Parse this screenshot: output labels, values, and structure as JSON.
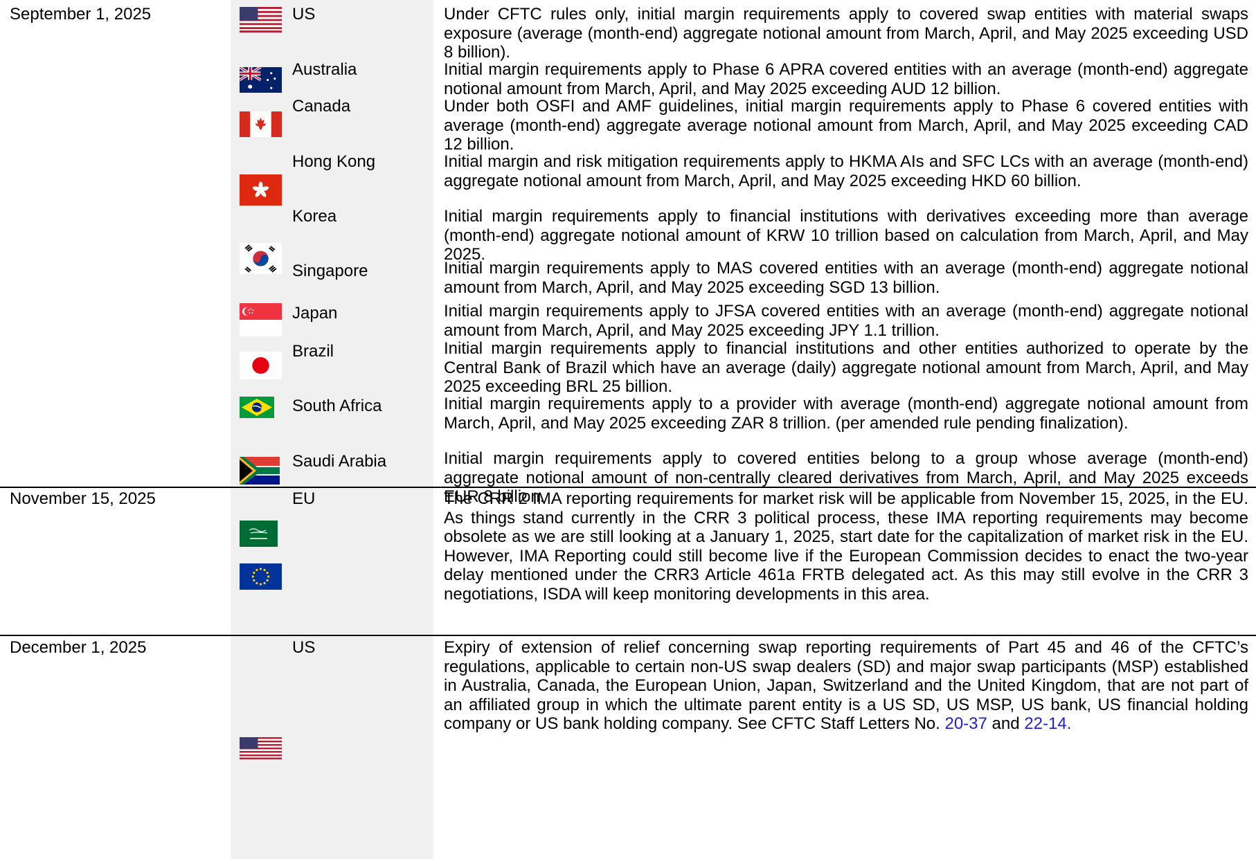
{
  "colors": {
    "accent_link": "#1f1fd6",
    "column_shade": "#f0f0f0",
    "rule": "#000000"
  },
  "groups": [
    {
      "date": "September 1, 2025",
      "rows": [
        {
          "flag_icon": "us-flag-icon",
          "country": "US",
          "text": "Under CFTC rules only, initial margin requirements apply to covered swap entities with material swaps exposure (average (month-end) aggregate notional amount from March, April, and May 2025 exceeding USD 8 billion)."
        },
        {
          "flag_icon": "australia-flag-icon",
          "country": "Australia",
          "text": "Initial margin requirements apply to Phase 6 APRA covered entities with an average (month-end) aggregate notional amount from March, April, and May 2025 exceeding AUD 12 billion."
        },
        {
          "flag_icon": "canada-flag-icon",
          "country": "Canada",
          "text": "Under both OSFI and AMF guidelines, initial margin requirements apply to Phase 6 covered entities with average (month-end) aggregate average notional amount from March, April, and May 2025 exceeding CAD 12 billion."
        },
        {
          "flag_icon": "hong-kong-flag-icon",
          "country": "Hong Kong",
          "text": "Initial margin and risk mitigation requirements apply to HKMA AIs and SFC LCs with an average (month-end) aggregate notional amount from March, April, and May 2025 exceeding HKD 60 billion."
        },
        {
          "flag_icon": "korea-flag-icon",
          "country": "Korea",
          "text": "Initial margin requirements apply to financial institutions with derivatives exceeding more than average (month-end) aggregate notional amount of KRW 10 trillion based on calculation from March, April, and May 2025."
        },
        {
          "flag_icon": "singapore-flag-icon",
          "country": "Singapore",
          "text": "Initial margin requirements apply to MAS covered entities with an average (month-end) aggregate notional amount from March, April, and May 2025 exceeding SGD 13 billion."
        },
        {
          "flag_icon": "japan-flag-icon",
          "country": "Japan",
          "text": "Initial margin requirements apply to JFSA covered entities with an average (month-end) aggregate notional amount from March, April, and May 2025 exceeding JPY 1.1 trillion."
        },
        {
          "flag_icon": "brazil-flag-icon",
          "country": "Brazil",
          "text": "Initial margin requirements apply to financial institutions and other entities authorized to operate by the Central Bank of Brazil which have an average (daily) aggregate notional amount from March, April, and May 2025 exceeding BRL 25 billion."
        },
        {
          "flag_icon": "south-africa-flag-icon",
          "country": "South Africa",
          "text": "Initial margin requirements apply to a provider with average (month-end) aggregate notional amount from March, April, and May 2025 exceeding ZAR 8 trillion. (per amended rule pending finalization)."
        },
        {
          "flag_icon": "saudi-arabia-flag-icon",
          "country": "Saudi Arabia",
          "text": "Initial margin requirements apply to covered entities belong to a group whose average (month-end) aggregate notional amount of non-centrally cleared derivatives from March, April, and May 2025 exceeds EUR 8 billion."
        }
      ]
    },
    {
      "date": "November 15, 2025",
      "rows": [
        {
          "flag_icon": "eu-flag-icon",
          "country": "EU",
          "text": "The CRR 2 IMA reporting requirements for market risk will be applicable from November 15, 2025, in the EU. As things stand currently in the CRR 3 political process, these IMA reporting requirements may become obsolete as we are still looking at a January 1, 2025, start date for the capitalization of market risk in the EU. However, IMA Reporting could still become live if the European Commission decides to enact the two-year delay mentioned under the CRR3 Article 461a FRTB delegated act. As this may still evolve in the CRR 3 negotiations, ISDA will keep monitoring developments in this area."
        }
      ]
    },
    {
      "date": "December 1, 2025",
      "rows": [
        {
          "flag_icon": "us-flag-icon",
          "country": "US",
          "text": "Expiry of extension of relief concerning swap reporting requirements of Part 45 and 46 of the CFTC’s regulations, applicable to certain non-US swap dealers (SD) and major swap participants (MSP) established in Australia, Canada, the European Union, Japan, Switzerland and the United Kingdom, that are not part of an affiliated group in which the ultimate parent entity is a US SD, US MSP, US bank, US financial holding company or US bank holding company. See CFTC Staff Letters No. ",
          "link1": "20-37",
          "connector": " and ",
          "link2": "22-14",
          "tail": "."
        }
      ]
    }
  ]
}
